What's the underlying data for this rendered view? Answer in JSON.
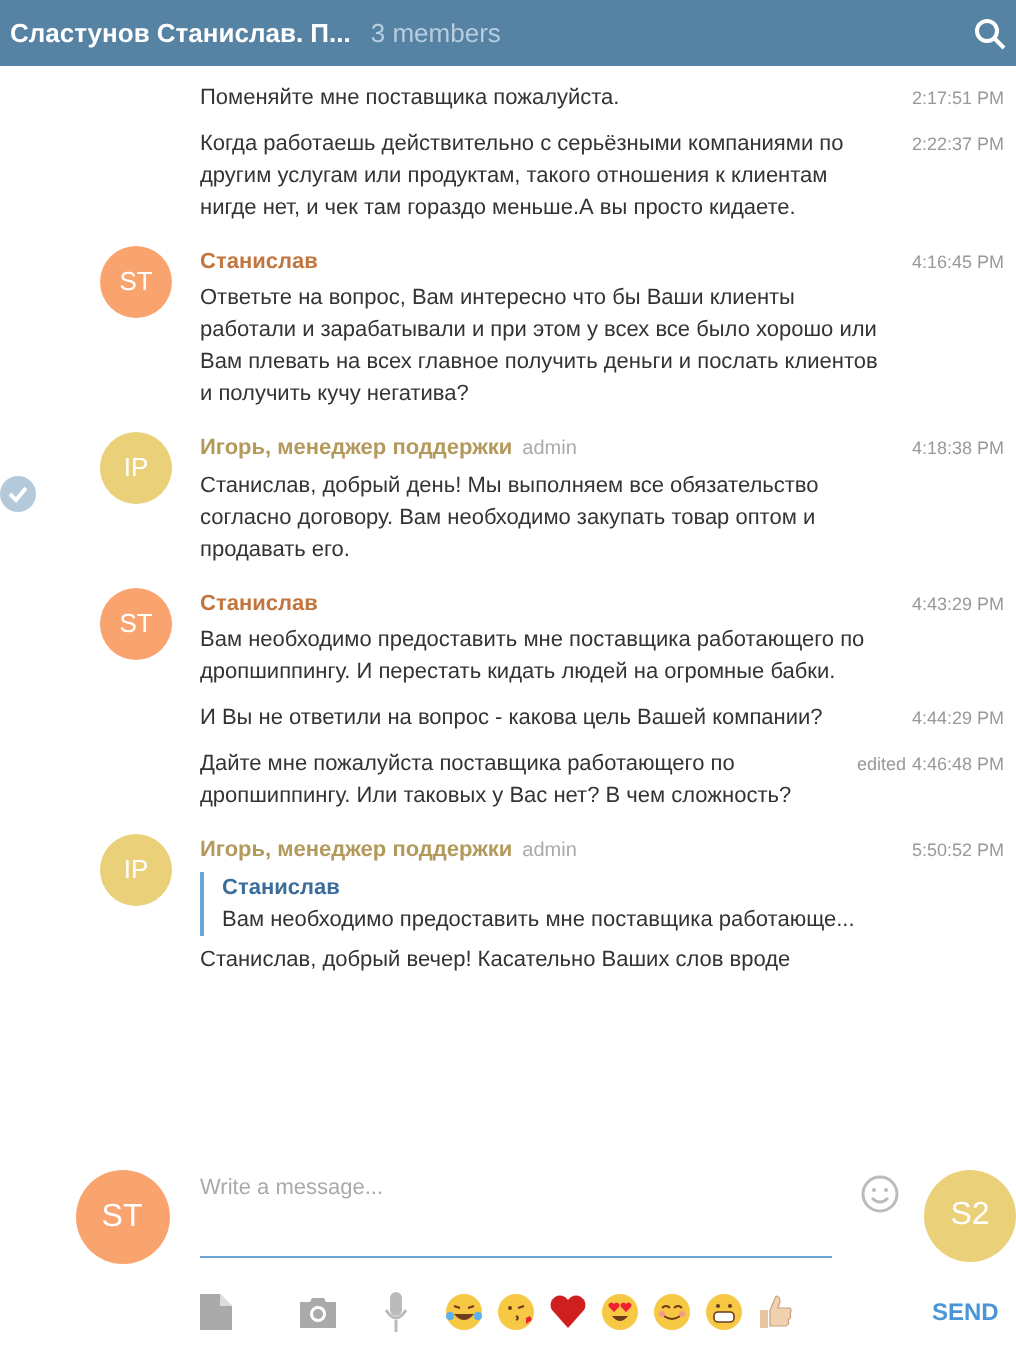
{
  "header": {
    "title": "Сластунов Станислав. П...",
    "members": "3 members"
  },
  "messages": [
    {
      "kind": "continuation",
      "selected": false,
      "text": "Поменяйте мне поставщика пожалуйста.",
      "time": "2:17:51 PM"
    },
    {
      "kind": "continuation",
      "selected": false,
      "text": "Когда работаешь действительно с серьёзными компаниями по другим услугам или продуктам, такого отношения к клиентам нигде нет, и чек там гораздо меньше.А вы просто кидаете.",
      "time": "2:22:37 PM"
    },
    {
      "kind": "first",
      "selected": false,
      "avatar": {
        "initials": "ST",
        "color": "#f9a36e"
      },
      "author": {
        "name": "Станислав",
        "color": "#c2753f"
      },
      "time": "4:16:45 PM",
      "text": "Ответьте на вопрос, Вам интересно что бы Ваши клиенты работали и зарабатывали и при этом у всех все было хорошо или Вам плевать на всех главное получить деньги и послать клиентов и получить кучу негатива?"
    },
    {
      "kind": "first",
      "selected": true,
      "avatar": {
        "initials": "IP",
        "color": "#ebd07a"
      },
      "author": {
        "name": "Игорь, менеджер поддержки",
        "color": "#b39a5c"
      },
      "badge": "admin",
      "time": "4:18:38 PM",
      "text": "Станислав, добрый день! Мы выполняем все обязательство согласно договору. Вам необходимо закупать товар оптом и продавать его."
    },
    {
      "kind": "first",
      "selected": false,
      "avatar": {
        "initials": "ST",
        "color": "#f9a36e"
      },
      "author": {
        "name": "Станислав",
        "color": "#c2753f"
      },
      "time": "4:43:29 PM",
      "text": "Вам необходимо предоставить мне поставщика работающего по дропшиппингу. И перестать кидать людей на огромные бабки."
    },
    {
      "kind": "continuation",
      "selected": false,
      "text": "И Вы не ответили на вопрос - какова цель Вашей компании?",
      "time": "4:44:29 PM"
    },
    {
      "kind": "continuation",
      "selected": false,
      "text": "Дайте мне пожалуйста поставщика работающего по дропшиппингу. Или таковых у Вас нет? В чем сложность?",
      "edited": "edited",
      "time": "4:46:48 PM"
    },
    {
      "kind": "first",
      "selected": false,
      "avatar": {
        "initials": "IP",
        "color": "#ebd07a"
      },
      "author": {
        "name": "Игорь, менеджер поддержки",
        "color": "#b39a5c"
      },
      "badge": "admin",
      "time": "5:50:52 PM",
      "reply": {
        "author": "Станислав",
        "text": "Вам необходимо предоставить мне поставщика работающе..."
      },
      "text": "Станислав, добрый вечер! Касательно Ваших слов вроде"
    }
  ],
  "compose": {
    "avatar": {
      "initials": "ST",
      "color": "#f9a36e"
    },
    "placeholder": "Write a message...",
    "other_avatar": {
      "initials": "S2",
      "color": "#ebd07a"
    },
    "send": "SEND"
  }
}
